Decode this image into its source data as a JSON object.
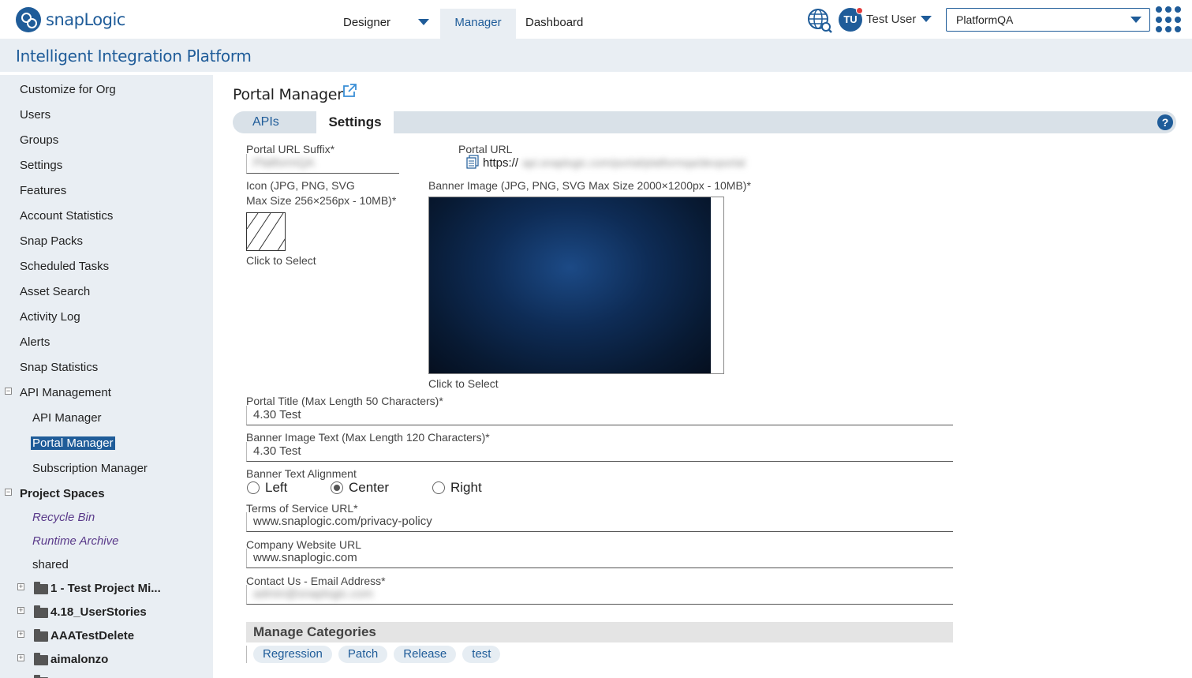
{
  "brand": {
    "logo_text": "snapLogic",
    "accent": "#1f5c99"
  },
  "topnav": {
    "designer": "Designer",
    "manager": "Manager",
    "dashboard": "Dashboard"
  },
  "user": {
    "initials": "TU",
    "name": "Test User"
  },
  "org": {
    "selected": "PlatformQA"
  },
  "app_title": "Intelligent Integration Platform",
  "sidebar": {
    "items": [
      "Customize for Org",
      "Users",
      "Groups",
      "Settings",
      "Features",
      "Account Statistics",
      "Snap Packs",
      "Scheduled Tasks",
      "Asset Search",
      "Activity Log",
      "Alerts",
      "Snap Statistics"
    ],
    "api_management": {
      "label": "API Management",
      "children": [
        "API Manager",
        "Portal Manager",
        "Subscription Manager"
      ]
    },
    "project_spaces": {
      "label": "Project Spaces",
      "special": [
        "Recycle Bin",
        "Runtime Archive"
      ],
      "shared": "shared",
      "folders": [
        "1 - Test Project Mi...",
        "4.18_UserStories",
        "AAATestDelete",
        "aimalonzo"
      ]
    }
  },
  "page": {
    "title": "Portal Manager",
    "tabs": {
      "apis": "APIs",
      "settings": "Settings"
    },
    "help": "?"
  },
  "form": {
    "portal_url_suffix": {
      "label": "Portal URL Suffix*",
      "value": "PlatformQA"
    },
    "portal_url": {
      "label": "Portal URL",
      "prefix": "https://",
      "value": "api.snaplogic.com/portal/platformqa/devportal"
    },
    "icon": {
      "label_line1": "Icon (JPG, PNG, SVG",
      "label_line2": "Max Size 256×256px - 10MB)*",
      "click": "Click to Select"
    },
    "banner": {
      "label": "Banner Image (JPG, PNG, SVG Max Size 2000×1200px - 10MB)*",
      "click": "Click to Select"
    },
    "portal_title": {
      "label": "Portal Title (Max Length 50 Characters)*",
      "value": "4.30 Test"
    },
    "banner_text": {
      "label": "Banner Image Text (Max Length 120 Characters)*",
      "value": "4.30 Test"
    },
    "alignment": {
      "label": "Banner Text Alignment",
      "options": [
        "Left",
        "Center",
        "Right"
      ],
      "selected": "Center"
    },
    "tos_url": {
      "label": "Terms of Service URL*",
      "value": "www.snaplogic.com/privacy-policy"
    },
    "company_url": {
      "label": "Company Website URL",
      "value": "www.snaplogic.com"
    },
    "contact_email": {
      "label": "Contact Us - Email Address*",
      "value": "admin@snaplogic.com"
    }
  },
  "categories": {
    "header": "Manage Categories",
    "items": [
      "Regression",
      "Patch",
      "Release",
      "test"
    ]
  }
}
